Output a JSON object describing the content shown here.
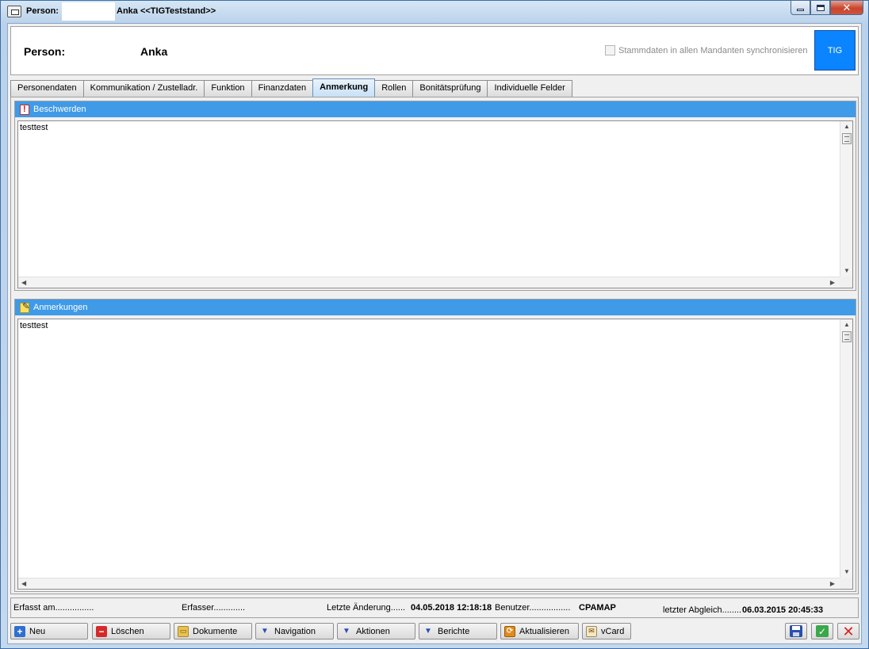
{
  "window": {
    "title_prefix": "Person:",
    "title_name": "Anka  <<TIGTeststand>>",
    "minimize_icon": "minimize-icon",
    "maximize_icon": "maximize-icon",
    "close_label": "✕"
  },
  "header": {
    "label": "Person:",
    "value": "Anka",
    "sync_label": "Stammdaten in allen Mandanten synchronisieren",
    "sync_checked": false,
    "tig_label": "TIG",
    "tig_color": "#0a84ff"
  },
  "tabs": [
    {
      "label": "Personendaten",
      "active": false
    },
    {
      "label": "Kommunikation / Zustelladr.",
      "active": false
    },
    {
      "label": "Funktion",
      "active": false
    },
    {
      "label": "Finanzdaten",
      "active": false
    },
    {
      "label": "Anmerkung",
      "active": true
    },
    {
      "label": "Rollen",
      "active": false
    },
    {
      "label": "Bonitätsprüfung",
      "active": false
    },
    {
      "label": "Individuelle Felder",
      "active": false
    }
  ],
  "sections": {
    "complaints": {
      "title": "Beschwerden",
      "text": "testtest"
    },
    "notes": {
      "title": "Anmerkungen",
      "text": "testtest"
    }
  },
  "status": {
    "created_label": "Erfasst am................",
    "creator_label": "Erfasser.............",
    "changed_label": "Letzte Änderung......",
    "changed_value": "04.05.2018 12:18:18",
    "user_label": "Benutzer.................",
    "user_value": "CPAMAP",
    "sync_label": "letzter Abgleich........",
    "sync_value": "06.03.2015 20:45:33"
  },
  "buttons": {
    "new": "Neu",
    "delete": "Löschen",
    "documents": "Dokumente",
    "navigation": "Navigation",
    "actions": "Aktionen",
    "reports": "Berichte",
    "refresh": "Aktualisieren",
    "vcard": "vCard"
  },
  "colors": {
    "section_header": "#3f9ae8",
    "accent": "#0a84ff"
  }
}
